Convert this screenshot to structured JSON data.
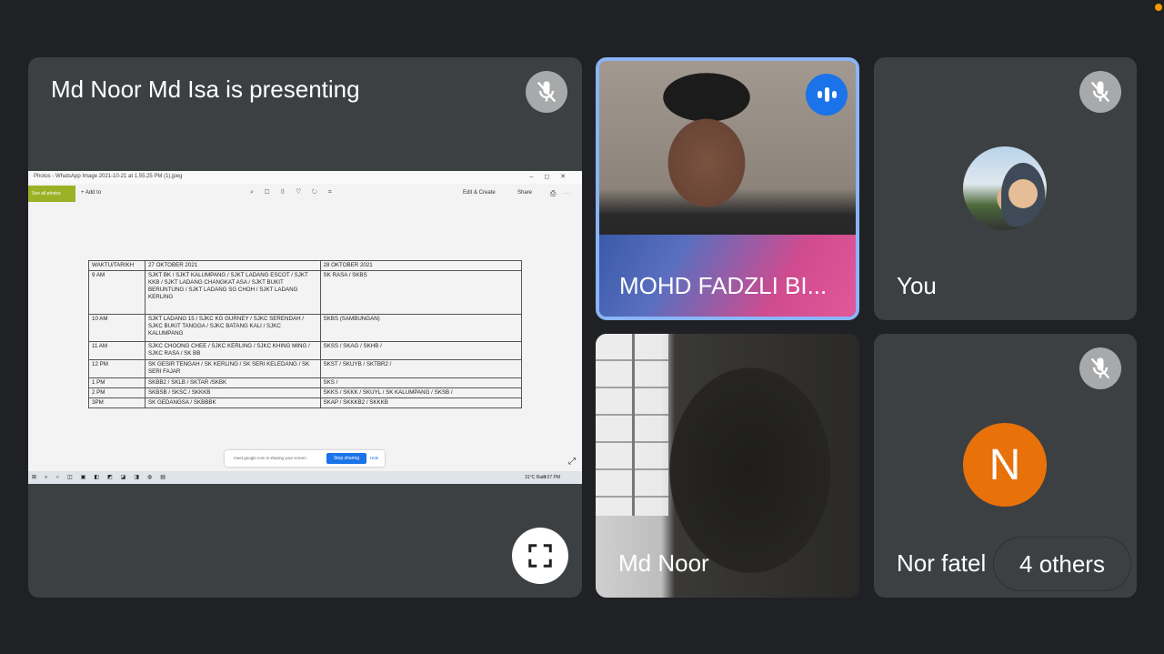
{
  "presentation": {
    "title": "Md Noor Md Isa is presenting"
  },
  "shared_screen": {
    "window_title": "Photos - WhatsApp Image 2021-10-21 at 1.55.25 PM (1).jpeg",
    "toolbar": {
      "see_all": "See all photos",
      "add_to": "+ Add to",
      "edit_create": "Edit & Create",
      "share": "Share"
    },
    "table": {
      "headers": [
        "WAKTU/TARIKH",
        "27 OKTOBER 2021",
        "28 OKTOBER 2021"
      ],
      "rows": [
        [
          "9 AM",
          "SJKT BK / SJKT KALUMPANG / SJKT LADANG ESCOT / SJKT KKB / SJKT LADANG CHANGKAT ASA / SJKT BUKIT BERUNTUNG / SJKT LADANG SG CHOH / SJKT LADANG KERLING",
          "SK RASA / SKBS"
        ],
        [
          "10 AM",
          "SJKT LADANG 15 / SJKC KG GURNEY / SJKC SERENDAH / SJKC BUKIT TANGGA / SJKC BATANG KALI / SJKC KALUMPANG",
          "SKBS (SAMBUNGAN)"
        ],
        [
          "11 AM",
          "SJKC CHOONG CHEE / SJKC KERLING / SJKC KHING MING / SJKC RASA / SK BB",
          "SKSS / SKAG / SKHB /"
        ],
        [
          "12 PM",
          "SK GESIR TENGAH / SK KERLING / SK SERI KELEDANG / SK SERI FAJAR",
          "SKST / SKUYB / SKTBR2 /"
        ],
        [
          "1 PM",
          "SKBB2 / SKLB / SKTAR /SKBK",
          "SKS /"
        ],
        [
          "2 PM",
          "SKBSB / SKSC / SKKKB",
          "SKKS / SKKK / SKUYL / SK KALUMPANG / SKSB /"
        ],
        [
          "3PM",
          "SK GEDANGSA / SKBBBK",
          "SKAP / SKKKB2 / SKKKB"
        ]
      ]
    },
    "share_bar": {
      "message": "meet.google.com is sharing your screen.",
      "stop_label": "Stop sharing",
      "hide_label": "Hide"
    },
    "taskbar": {
      "weather": "31°C  Rain",
      "time": "3:07 PM"
    }
  },
  "participants": [
    {
      "name": "MOHD FADZLI BI...",
      "state": "speaking"
    },
    {
      "name": "You",
      "state": "muted"
    },
    {
      "name": "Md Noor",
      "state": "video"
    },
    {
      "name": "Nor fatel",
      "state": "muted",
      "avatar_letter": "N"
    }
  ],
  "others_label": "4 others",
  "colors": {
    "background": "#202124",
    "tile": "#3c4043",
    "active_speaker_border": "#8ab4f8",
    "speaking_indicator": "#1a73e8",
    "avatar_n": "#e8710a"
  }
}
